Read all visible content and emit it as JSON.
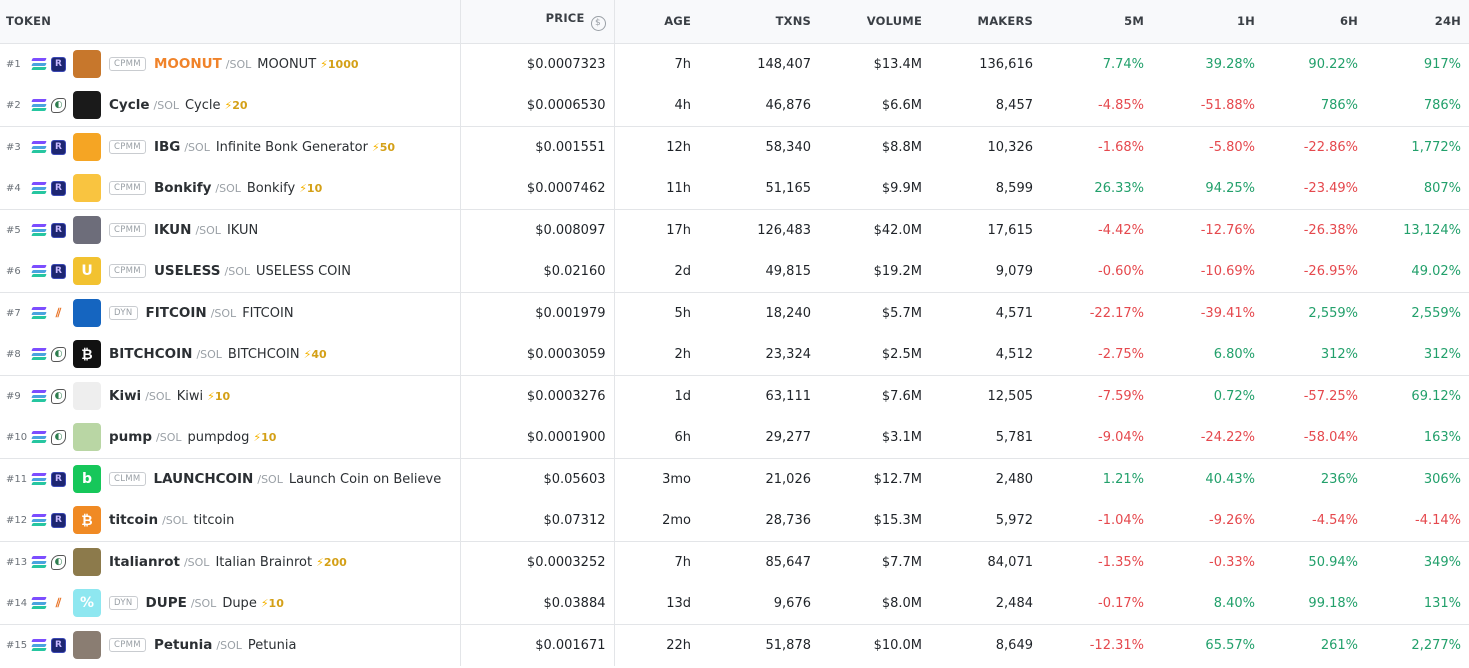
{
  "columns": {
    "token": "TOKEN",
    "price": "PRICE",
    "price_icon": "$",
    "age": "AGE",
    "txns": "TXNS",
    "volume": "VOLUME",
    "makers": "MAKERS",
    "m5": "5M",
    "h1": "1H",
    "h6": "6H",
    "h24": "24H"
  },
  "colors": {
    "positive": "#22a06b",
    "negative": "#e5484d",
    "boost": "#d4a017",
    "highlight_symbol": "#f0832a"
  },
  "rows": [
    {
      "rank": "#1",
      "dex": "raydium-icon",
      "badge": "CPMM",
      "symbol": "MOONUT",
      "quote": "/SOL",
      "name": "MOONUT",
      "boost": "1000",
      "price": "$0.0007323",
      "age": "7h",
      "txns": "148,407",
      "volume": "$13.4M",
      "makers": "136,616",
      "m5": "7.74%",
      "h1": "39.28%",
      "h6": "90.22%",
      "h24": "917%",
      "avatar": "owl-avatar"
    },
    {
      "rank": "#2",
      "dex": "pumpswap-icon",
      "badge": "",
      "symbol": "Cycle",
      "quote": "/SOL",
      "name": "Cycle",
      "boost": "20",
      "price": "$0.0006530",
      "age": "4h",
      "txns": "46,876",
      "volume": "$6.6M",
      "makers": "8,457",
      "m5": "-4.85%",
      "h1": "-51.88%",
      "h6": "786%",
      "h24": "786%",
      "avatar": "spiral-avatar"
    },
    {
      "rank": "#3",
      "dex": "raydium-icon",
      "badge": "CPMM",
      "symbol": "IBG",
      "quote": "/SOL",
      "name": "Infinite Bonk Generator",
      "boost": "50",
      "price": "$0.001551",
      "age": "12h",
      "txns": "58,340",
      "volume": "$8.8M",
      "makers": "10,326",
      "m5": "-1.68%",
      "h1": "-5.80%",
      "h6": "-22.86%",
      "h24": "1,772%",
      "avatar": "orange-avatar"
    },
    {
      "rank": "#4",
      "dex": "raydium-icon",
      "badge": "CPMM",
      "symbol": "Bonkify",
      "quote": "/SOL",
      "name": "Bonkify",
      "boost": "10",
      "price": "$0.0007462",
      "age": "11h",
      "txns": "51,165",
      "volume": "$9.9M",
      "makers": "8,599",
      "m5": "26.33%",
      "h1": "94.25%",
      "h6": "-23.49%",
      "h24": "807%",
      "avatar": "stack-avatar"
    },
    {
      "rank": "#5",
      "dex": "raydium-icon",
      "badge": "CPMM",
      "symbol": "IKUN",
      "quote": "/SOL",
      "name": "IKUN",
      "boost": "",
      "price": "$0.008097",
      "age": "17h",
      "txns": "126,483",
      "volume": "$42.0M",
      "makers": "17,615",
      "m5": "-4.42%",
      "h1": "-12.76%",
      "h6": "-26.38%",
      "h24": "13,124%",
      "avatar": "cartoon-avatar"
    },
    {
      "rank": "#6",
      "dex": "raydium-icon",
      "badge": "CPMM",
      "symbol": "USELESS",
      "quote": "/SOL",
      "name": "USELESS COIN",
      "boost": "",
      "price": "$0.02160",
      "age": "2d",
      "txns": "49,815",
      "volume": "$19.2M",
      "makers": "9,079",
      "m5": "-0.60%",
      "h1": "-10.69%",
      "h6": "-26.95%",
      "h24": "49.02%",
      "avatar": "coin-avatar"
    },
    {
      "rank": "#7",
      "dex": "meteora-icon",
      "badge": "DYN",
      "symbol": "FITCOIN",
      "quote": "/SOL",
      "name": "FITCOIN",
      "boost": "",
      "price": "$0.001979",
      "age": "5h",
      "txns": "18,240",
      "volume": "$5.7M",
      "makers": "4,571",
      "m5": "-22.17%",
      "h1": "-39.41%",
      "h6": "2,559%",
      "h24": "2,559%",
      "avatar": "cloud-avatar"
    },
    {
      "rank": "#8",
      "dex": "pumpswap-icon",
      "badge": "",
      "symbol": "BITCHCOIN",
      "quote": "/SOL",
      "name": "BITCHCOIN",
      "boost": "40",
      "price": "$0.0003059",
      "age": "2h",
      "txns": "23,324",
      "volume": "$2.5M",
      "makers": "4,512",
      "m5": "-2.75%",
      "h1": "6.80%",
      "h6": "312%",
      "h24": "312%",
      "avatar": "bitcoin-avatar"
    },
    {
      "rank": "#9",
      "dex": "pumpswap-icon",
      "badge": "",
      "symbol": "Kiwi",
      "quote": "/SOL",
      "name": "Kiwi",
      "boost": "10",
      "price": "$0.0003276",
      "age": "1d",
      "txns": "63,111",
      "volume": "$7.6M",
      "makers": "12,505",
      "m5": "-7.59%",
      "h1": "0.72%",
      "h6": "-57.25%",
      "h24": "69.12%",
      "avatar": "sketch-avatar"
    },
    {
      "rank": "#10",
      "dex": "pumpswap-icon",
      "badge": "",
      "symbol": "pump",
      "quote": "/SOL",
      "name": "pumpdog",
      "boost": "10",
      "price": "$0.0001900",
      "age": "6h",
      "txns": "29,277",
      "volume": "$3.1M",
      "makers": "5,781",
      "m5": "-9.04%",
      "h1": "-24.22%",
      "h6": "-58.04%",
      "h24": "163%",
      "avatar": "dog-avatar"
    },
    {
      "rank": "#11",
      "dex": "raydium-icon",
      "badge": "CLMM",
      "symbol": "LAUNCHCOIN",
      "quote": "/SOL",
      "name": "Launch Coin on Believe",
      "boost": "",
      "price": "$0.05603",
      "age": "3mo",
      "txns": "21,026",
      "volume": "$12.7M",
      "makers": "2,480",
      "m5": "1.21%",
      "h1": "40.43%",
      "h6": "236%",
      "h24": "306%",
      "avatar": "b-avatar"
    },
    {
      "rank": "#12",
      "dex": "raydium-icon",
      "badge": "",
      "symbol": "titcoin",
      "quote": "/SOL",
      "name": "titcoin",
      "boost": "",
      "price": "$0.07312",
      "age": "2mo",
      "txns": "28,736",
      "volume": "$15.3M",
      "makers": "5,972",
      "m5": "-1.04%",
      "h1": "-9.26%",
      "h6": "-4.54%",
      "h24": "-4.14%",
      "avatar": "titcoin-avatar"
    },
    {
      "rank": "#13",
      "dex": "pumpswap-icon",
      "badge": "",
      "symbol": "Italianrot",
      "quote": "/SOL",
      "name": "Italian Brainrot",
      "boost": "200",
      "price": "$0.0003252",
      "age": "7h",
      "txns": "85,647",
      "volume": "$7.7M",
      "makers": "84,071",
      "m5": "-1.35%",
      "h1": "-0.33%",
      "h6": "50.94%",
      "h24": "349%",
      "avatar": "brainrot-avatar"
    },
    {
      "rank": "#14",
      "dex": "meteora-icon",
      "badge": "DYN",
      "symbol": "DUPE",
      "quote": "/SOL",
      "name": "Dupe",
      "boost": "10",
      "price": "$0.03884",
      "age": "13d",
      "txns": "9,676",
      "volume": "$8.0M",
      "makers": "2,484",
      "m5": "-0.17%",
      "h1": "8.40%",
      "h6": "99.18%",
      "h24": "131%",
      "avatar": "dupe-avatar"
    },
    {
      "rank": "#15",
      "dex": "raydium-icon",
      "badge": "CPMM",
      "symbol": "Petunia",
      "quote": "/SOL",
      "name": "Petunia",
      "boost": "",
      "price": "$0.001671",
      "age": "22h",
      "txns": "51,878",
      "volume": "$10.0M",
      "makers": "8,649",
      "m5": "-12.31%",
      "h1": "65.57%",
      "h6": "261%",
      "h24": "2,277%",
      "avatar": "photo-avatar"
    }
  ]
}
